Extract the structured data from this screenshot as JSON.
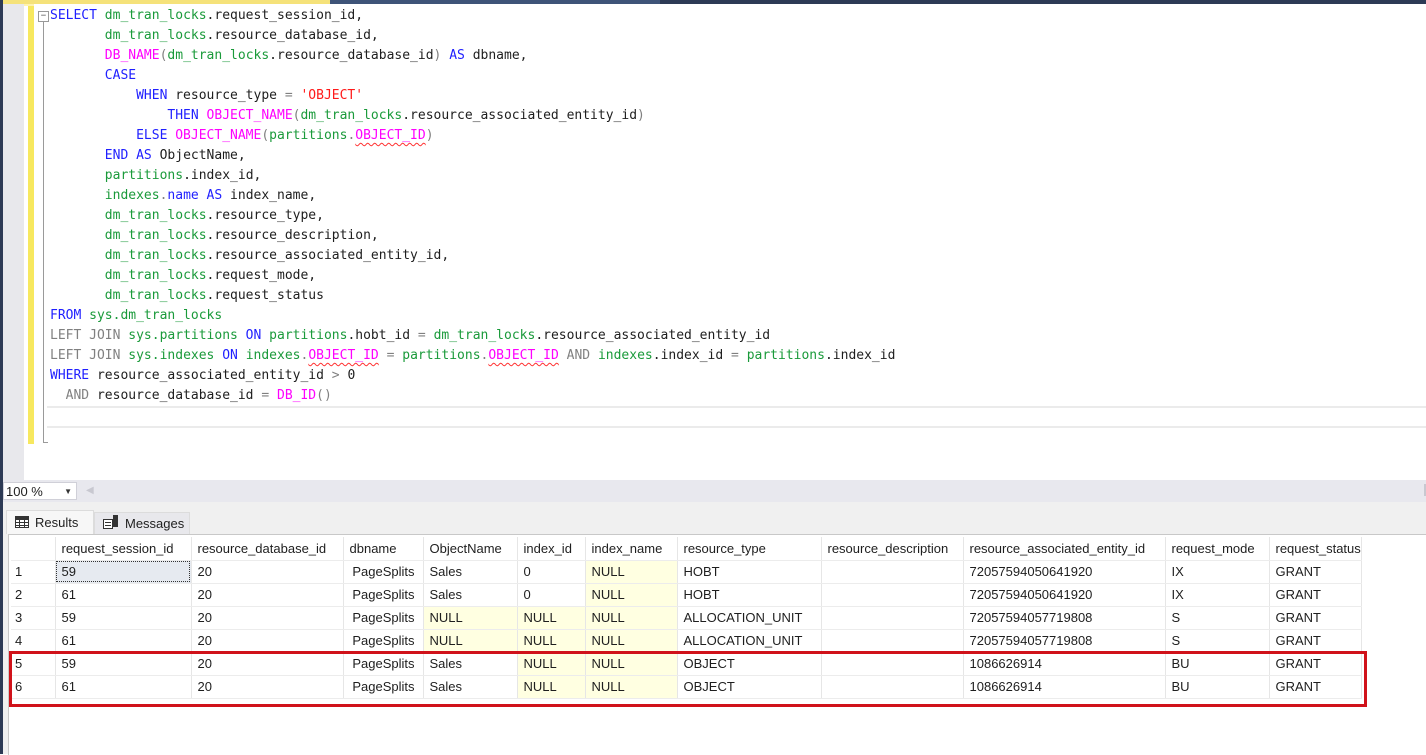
{
  "editor": {
    "lines": [
      [
        {
          "t": "SELECT ",
          "c": "kw"
        },
        {
          "t": "dm_tran_locks",
          "c": "sys"
        },
        {
          "t": ".request_session_id,",
          "c": ""
        }
      ],
      [
        {
          "t": "       ",
          "c": ""
        },
        {
          "t": "dm_tran_locks",
          "c": "sys"
        },
        {
          "t": ".resource_database_id,",
          "c": ""
        }
      ],
      [
        {
          "t": "       ",
          "c": ""
        },
        {
          "t": "DB_NAME",
          "c": "fn"
        },
        {
          "t": "(",
          "c": "gray"
        },
        {
          "t": "dm_tran_locks",
          "c": "sys"
        },
        {
          "t": ".resource_database_id",
          "c": ""
        },
        {
          "t": ")",
          "c": "gray"
        },
        {
          "t": " AS ",
          "c": "kw"
        },
        {
          "t": "dbname,",
          "c": ""
        }
      ],
      [
        {
          "t": "       ",
          "c": ""
        },
        {
          "t": "CASE",
          "c": "kw"
        }
      ],
      [
        {
          "t": "           ",
          "c": ""
        },
        {
          "t": "WHEN ",
          "c": "kw"
        },
        {
          "t": "resource_type ",
          "c": ""
        },
        {
          "t": "= ",
          "c": "gray"
        },
        {
          "t": "'OBJECT'",
          "c": "str"
        }
      ],
      [
        {
          "t": "               ",
          "c": ""
        },
        {
          "t": "THEN ",
          "c": "kw"
        },
        {
          "t": "OBJECT_NAME",
          "c": "fn"
        },
        {
          "t": "(",
          "c": "gray"
        },
        {
          "t": "dm_tran_locks",
          "c": "sys"
        },
        {
          "t": ".resource_associated_entity_id",
          "c": ""
        },
        {
          "t": ")",
          "c": "gray"
        }
      ],
      [
        {
          "t": "           ",
          "c": ""
        },
        {
          "t": "ELSE ",
          "c": "kw"
        },
        {
          "t": "OBJECT_NAME",
          "c": "fn"
        },
        {
          "t": "(",
          "c": "gray"
        },
        {
          "t": "partitions",
          "c": "sys"
        },
        {
          "t": ".",
          "c": "gray"
        },
        {
          "t": "OBJECT_ID",
          "c": "fn squig"
        },
        {
          "t": ")",
          "c": "gray"
        }
      ],
      [
        {
          "t": "       ",
          "c": ""
        },
        {
          "t": "END AS ",
          "c": "kw"
        },
        {
          "t": "ObjectName,",
          "c": ""
        }
      ],
      [
        {
          "t": "       ",
          "c": ""
        },
        {
          "t": "partitions",
          "c": "sys"
        },
        {
          "t": ".index_id,",
          "c": ""
        }
      ],
      [
        {
          "t": "       ",
          "c": ""
        },
        {
          "t": "indexes",
          "c": "sys"
        },
        {
          "t": ".",
          "c": "gray"
        },
        {
          "t": "name",
          "c": "kw"
        },
        {
          "t": " AS ",
          "c": "kw"
        },
        {
          "t": "index_name,",
          "c": ""
        }
      ],
      [
        {
          "t": "       ",
          "c": ""
        },
        {
          "t": "dm_tran_locks",
          "c": "sys"
        },
        {
          "t": ".resource_type,",
          "c": ""
        }
      ],
      [
        {
          "t": "       ",
          "c": ""
        },
        {
          "t": "dm_tran_locks",
          "c": "sys"
        },
        {
          "t": ".resource_description,",
          "c": ""
        }
      ],
      [
        {
          "t": "       ",
          "c": ""
        },
        {
          "t": "dm_tran_locks",
          "c": "sys"
        },
        {
          "t": ".resource_associated_entity_id,",
          "c": ""
        }
      ],
      [
        {
          "t": "       ",
          "c": ""
        },
        {
          "t": "dm_tran_locks",
          "c": "sys"
        },
        {
          "t": ".request_mode,",
          "c": ""
        }
      ],
      [
        {
          "t": "       ",
          "c": ""
        },
        {
          "t": "dm_tran_locks",
          "c": "sys"
        },
        {
          "t": ".request_status",
          "c": ""
        }
      ],
      [
        {
          "t": "FROM ",
          "c": "kw"
        },
        {
          "t": "sys.dm_tran_locks",
          "c": "sys"
        }
      ],
      [
        {
          "t": "LEFT JOIN ",
          "c": "gray"
        },
        {
          "t": "sys.partitions",
          "c": "sys"
        },
        {
          "t": " ON ",
          "c": "kw"
        },
        {
          "t": "partitions",
          "c": "sys"
        },
        {
          "t": ".hobt_id ",
          "c": ""
        },
        {
          "t": "= ",
          "c": "gray"
        },
        {
          "t": "dm_tran_locks",
          "c": "sys"
        },
        {
          "t": ".resource_associated_entity_id",
          "c": ""
        }
      ],
      [
        {
          "t": "LEFT JOIN ",
          "c": "gray"
        },
        {
          "t": "sys.indexes",
          "c": "sys"
        },
        {
          "t": " ON ",
          "c": "kw"
        },
        {
          "t": "indexes",
          "c": "sys"
        },
        {
          "t": ".",
          "c": "gray"
        },
        {
          "t": "OBJECT_ID",
          "c": "fn squig"
        },
        {
          "t": " = ",
          "c": "gray"
        },
        {
          "t": "partitions",
          "c": "sys"
        },
        {
          "t": ".",
          "c": "gray"
        },
        {
          "t": "OBJECT_ID",
          "c": "fn squig"
        },
        {
          "t": " AND ",
          "c": "gray"
        },
        {
          "t": "indexes",
          "c": "sys"
        },
        {
          "t": ".index_id ",
          "c": ""
        },
        {
          "t": "= ",
          "c": "gray"
        },
        {
          "t": "partitions",
          "c": "sys"
        },
        {
          "t": ".index_id",
          "c": ""
        }
      ],
      [
        {
          "t": "WHERE ",
          "c": "kw"
        },
        {
          "t": "resource_associated_entity_id ",
          "c": ""
        },
        {
          "t": "> ",
          "c": "gray"
        },
        {
          "t": "0",
          "c": ""
        }
      ],
      [
        {
          "t": "  AND ",
          "c": "gray"
        },
        {
          "t": "resource_database_id ",
          "c": ""
        },
        {
          "t": "= ",
          "c": "gray"
        },
        {
          "t": "DB_ID",
          "c": "fn"
        },
        {
          "t": "()",
          "c": "gray"
        }
      ]
    ]
  },
  "zoom": {
    "value": "100 %"
  },
  "tabs": {
    "results": "Results",
    "messages": "Messages"
  },
  "grid": {
    "columns": [
      "request_session_id",
      "resource_database_id",
      "dbname",
      "ObjectName",
      "index_id",
      "index_name",
      "resource_type",
      "resource_description",
      "resource_associated_entity_id",
      "request_mode",
      "request_status"
    ],
    "rows": [
      [
        "1",
        "59",
        "20",
        "PageSplits",
        "Sales",
        "0",
        "NULL",
        "HOBT",
        "",
        "72057594050641920",
        "IX",
        "GRANT"
      ],
      [
        "2",
        "61",
        "20",
        "PageSplits",
        "Sales",
        "0",
        "NULL",
        "HOBT",
        "",
        "72057594050641920",
        "IX",
        "GRANT"
      ],
      [
        "3",
        "59",
        "20",
        "PageSplits",
        "NULL",
        "NULL",
        "NULL",
        "ALLOCATION_UNIT",
        "",
        "72057594057719808",
        "S",
        "GRANT"
      ],
      [
        "4",
        "61",
        "20",
        "PageSplits",
        "NULL",
        "NULL",
        "NULL",
        "ALLOCATION_UNIT",
        "",
        "72057594057719808",
        "S",
        "GRANT"
      ],
      [
        "5",
        "59",
        "20",
        "PageSplits",
        "Sales",
        "NULL",
        "NULL",
        "OBJECT",
        "",
        "1086626914",
        "BU",
        "GRANT"
      ],
      [
        "6",
        "61",
        "20",
        "PageSplits",
        "Sales",
        "NULL",
        "NULL",
        "OBJECT",
        "",
        "1086626914",
        "BU",
        "GRANT"
      ]
    ],
    "highlighted_rows": [
      5,
      6
    ],
    "highlight_color": "#d0121a",
    "null_bg": "#ffffe1"
  }
}
